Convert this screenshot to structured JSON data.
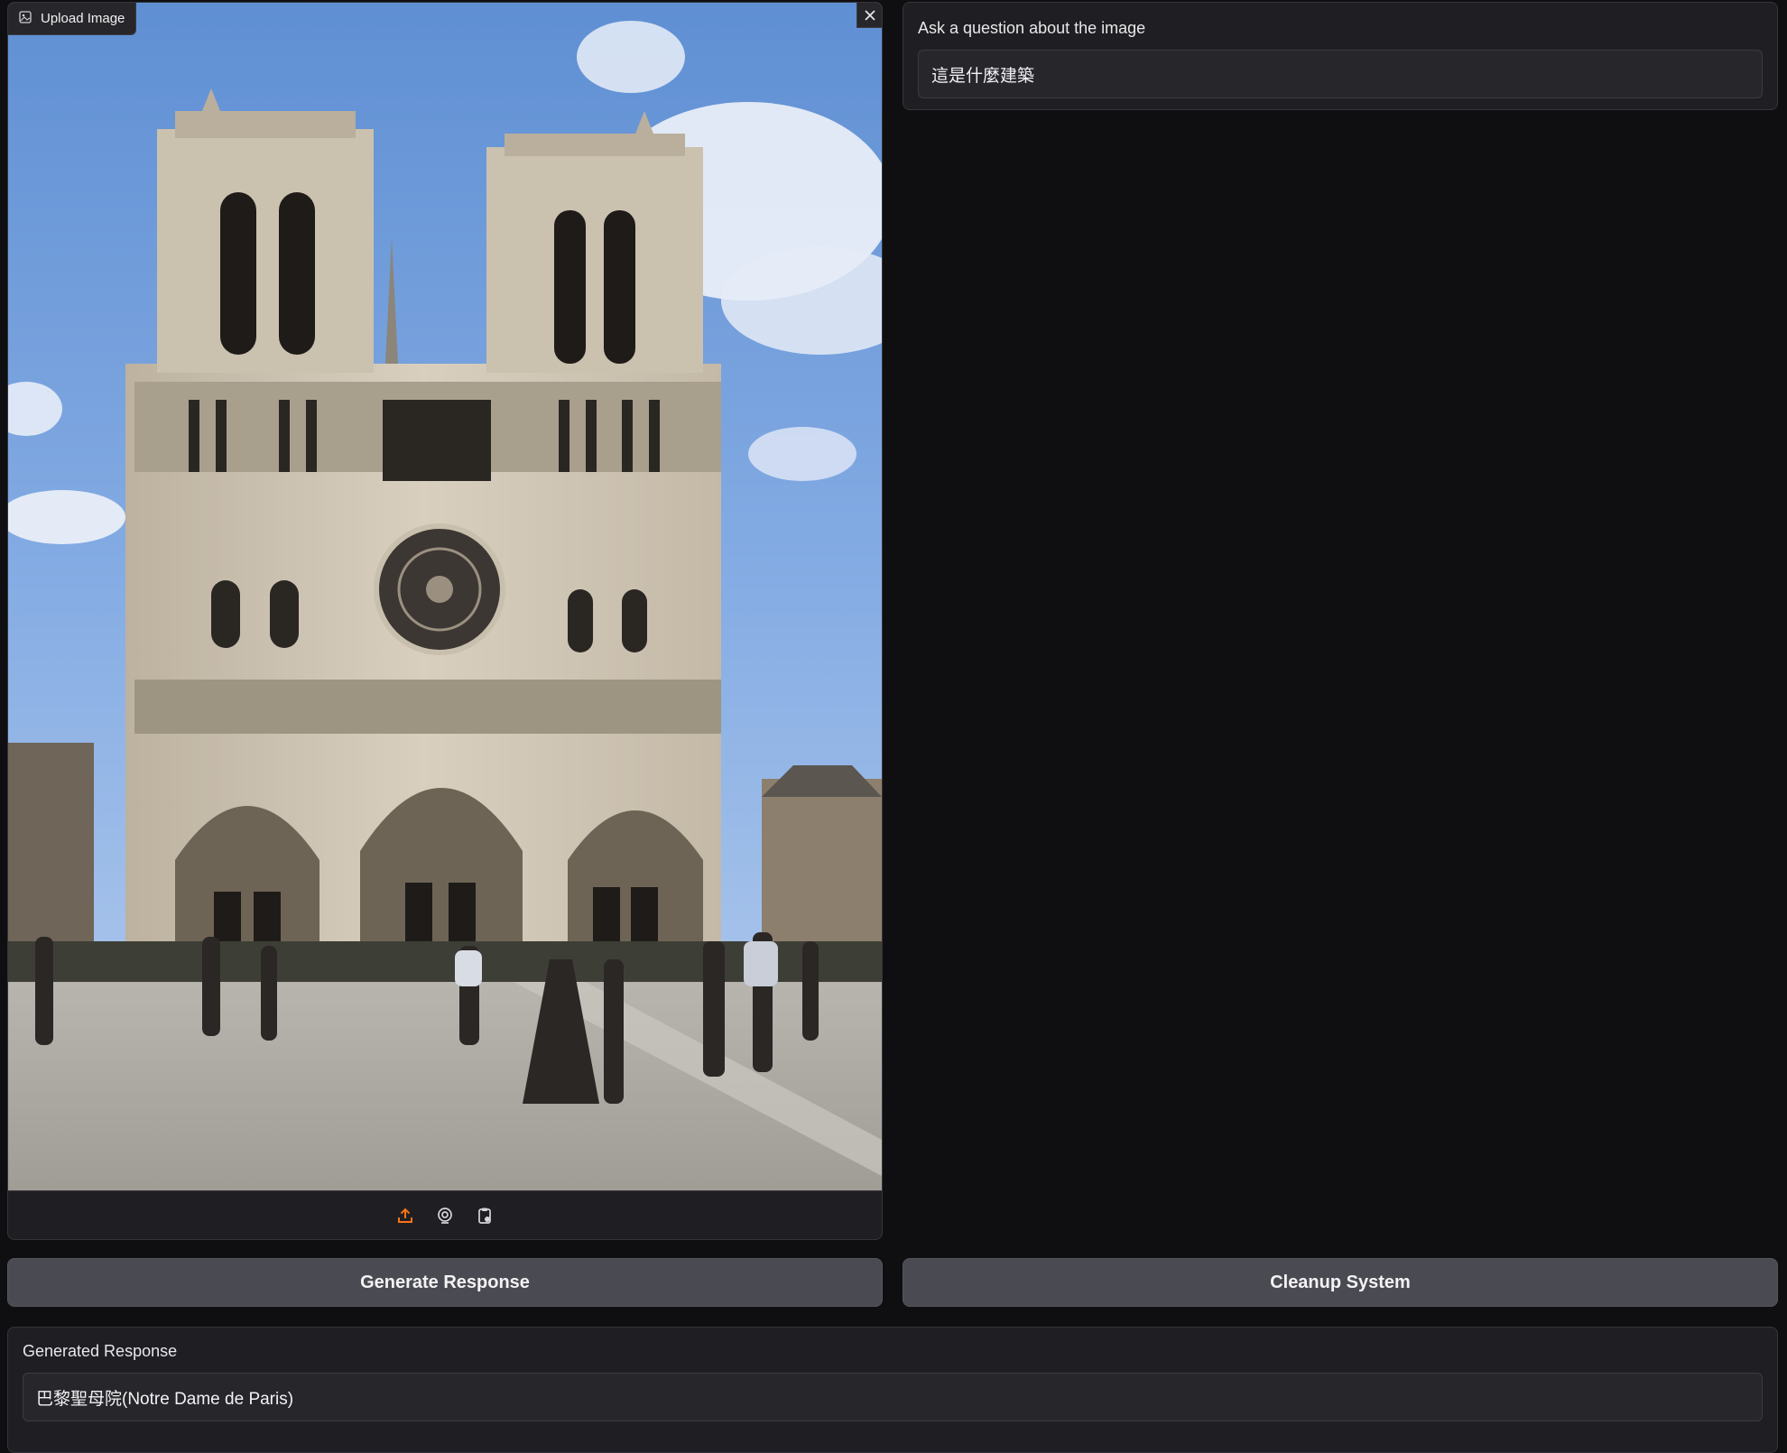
{
  "image_upload": {
    "label": "Upload Image",
    "icons": [
      "image-icon",
      "close-icon",
      "upload-icon",
      "webcam-icon",
      "clipboard-icon"
    ],
    "accent_color": "#f97316"
  },
  "question": {
    "label": "Ask a question about the image",
    "value": "這是什麼建築"
  },
  "buttons": {
    "generate_label": "Generate Response",
    "cleanup_label": "Cleanup System"
  },
  "response": {
    "label": "Generated Response",
    "value": "巴黎聖母院(Notre Dame de Paris)"
  }
}
